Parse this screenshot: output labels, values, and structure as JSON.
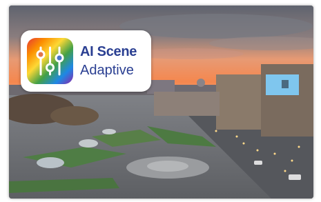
{
  "badge": {
    "title": "AI Scene",
    "subtitle": "Adaptive",
    "icon": "sliders-icon",
    "colors": {
      "text": "#2a3f92",
      "gradient": [
        "#e53935",
        "#fb8c00",
        "#fdd835",
        "#43a047",
        "#1e88e5",
        "#8e24aa"
      ]
    }
  },
  "photo": {
    "description_icon": "city-square-dusk-photo",
    "colors": {
      "sky_top": "#6b6f7a",
      "sunset": "#f28a55",
      "pavement": "#8d8f93"
    }
  }
}
